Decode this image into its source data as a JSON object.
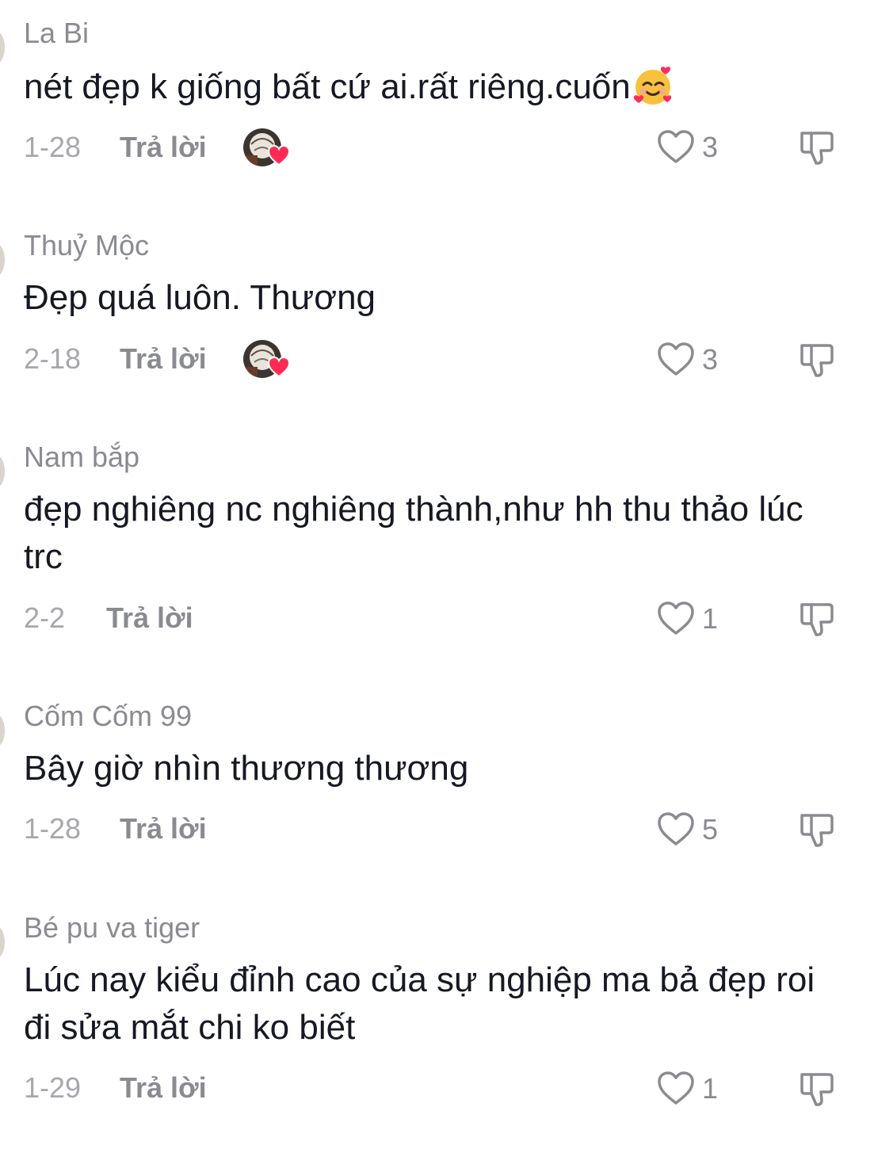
{
  "comments": [
    {
      "username": "La Bi",
      "text": "nét đẹp k giống bất cứ ai.rất riêng.cuốn",
      "has_emoji": true,
      "emoji_icon": "smiling-face-with-hearts",
      "date": "1-28",
      "reply_label": "Trả lời",
      "creator_liked": true,
      "likes": "3"
    },
    {
      "username": "Thuỷ Mộc",
      "text": "Đẹp quá luôn. Thương",
      "has_emoji": false,
      "date": "2-18",
      "reply_label": "Trả lời",
      "creator_liked": true,
      "likes": "3"
    },
    {
      "username": "Nam bắp",
      "text": "đẹp nghiêng nc nghiêng thành,như hh thu thảo lúc trc",
      "has_emoji": false,
      "date": "2-2",
      "reply_label": "Trả lời",
      "creator_liked": false,
      "likes": "1"
    },
    {
      "username": "Cốm Cốm 99",
      "text": "Bây giờ nhìn thương thương",
      "has_emoji": false,
      "date": "1-28",
      "reply_label": "Trả lời",
      "creator_liked": false,
      "likes": "5"
    },
    {
      "username": "Bé pu va tiger",
      "text": "Lúc nay kiểu đỉnh cao của sự nghiệp ma bả đẹp roi đi sửa mắt chi ko biết",
      "has_emoji": false,
      "date": "1-29",
      "reply_label": "Trả lời",
      "creator_liked": false,
      "likes": "1"
    }
  ],
  "icons": {
    "like": "heart-outline-icon",
    "dislike": "thumbs-down-icon",
    "creator_heart": "red-heart-icon"
  },
  "colors": {
    "text_primary": "#161823",
    "text_secondary": "#8a8b91",
    "heart_red": "#fe2c55"
  }
}
